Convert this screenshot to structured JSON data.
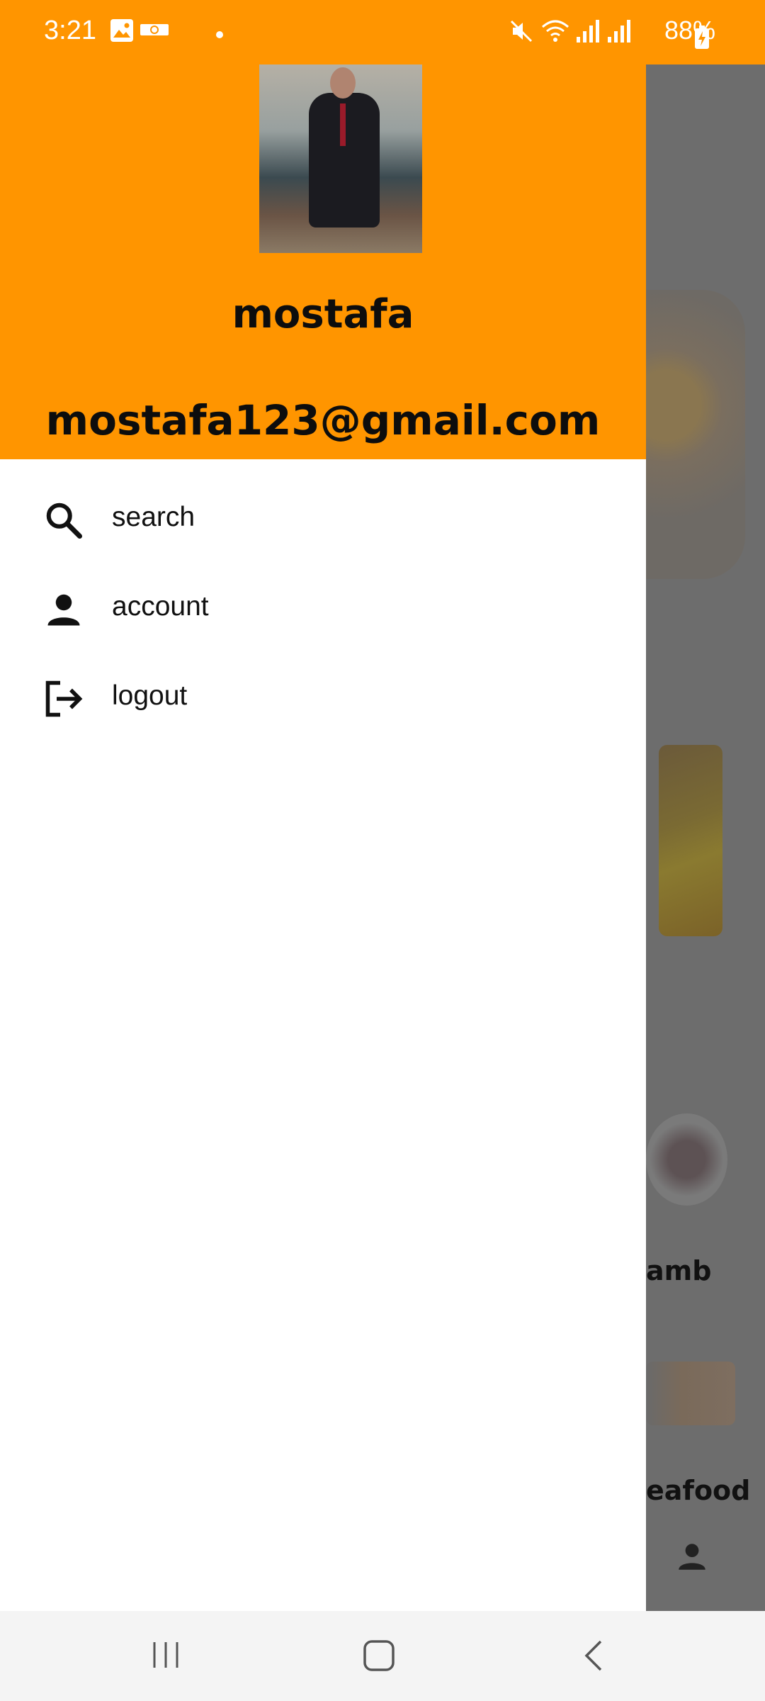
{
  "status_bar": {
    "time": "3:21",
    "battery": "88%",
    "icons": [
      "gallery-icon",
      "notification-icon",
      "dot-icon",
      "mute-icon",
      "wifi-icon",
      "signal-icon",
      "battery-charging-icon"
    ]
  },
  "drawer": {
    "header_color": "#ff9500",
    "user": {
      "name": "mostafa",
      "email": "mostafa123@gmail.com"
    },
    "menu": [
      {
        "label": "search",
        "icon": "search-icon"
      },
      {
        "label": "account",
        "icon": "person-icon"
      },
      {
        "label": "logout",
        "icon": "logout-icon"
      }
    ]
  },
  "background": {
    "labels": [
      "amb",
      "eafood"
    ]
  },
  "nav_bar": {
    "buttons": [
      "recents-button",
      "home-button",
      "back-button"
    ]
  }
}
